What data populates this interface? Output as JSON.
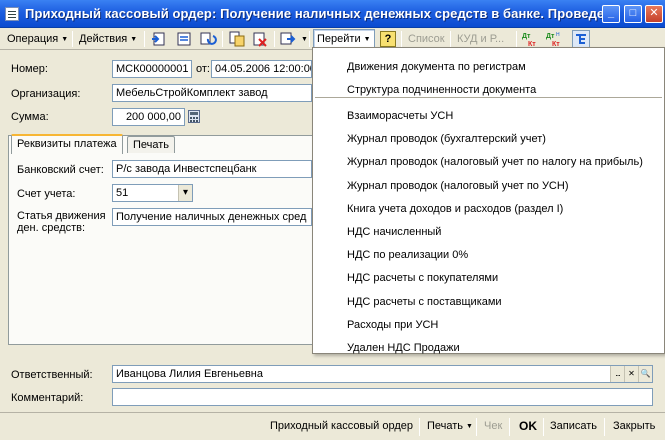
{
  "window": {
    "title": "Приходный кассовый ордер: Получение наличных денежных средств в банке. Проведен",
    "minimize_glyph": "_",
    "maximize_glyph": "□",
    "close_glyph": "✕"
  },
  "toolbar": {
    "operation_label": "Операция",
    "actions_label": "Действия",
    "goto_label": "Перейти",
    "help_glyph": "?",
    "list_label": "Список",
    "kud_label": "КУД и Р...",
    "dt_kt_1": "ДтКт",
    "dt_kt_2": "ДтНКт"
  },
  "form": {
    "number_label": "Номер:",
    "number_value": "МСК00000001",
    "from_label": "от:",
    "date_value": "04.05.2006 12:00:00",
    "org_label": "Организация:",
    "org_value": "МебельСтройКомплект завод",
    "sum_label": "Сумма:",
    "sum_value": "200 000,00",
    "tabs": [
      {
        "label": "Реквизиты платежа",
        "active": true
      },
      {
        "label": "Печать",
        "active": false
      }
    ],
    "bank_label": "Банковский счет:",
    "bank_value": "Р/с завода Инвестспецбанк",
    "account_label": "Счет учета:",
    "account_value": "51",
    "cashflow_label_1": "Статья движения",
    "cashflow_label_2": "ден. средств:",
    "cashflow_value": "Получение наличных денежных сред",
    "responsible_label": "Ответственный:",
    "responsible_value": "Иванцова Лилия Евгеньевна",
    "comment_label": "Комментарий:",
    "comment_value": ""
  },
  "menu": {
    "top_items": [
      "Движения документа по регистрам",
      "Структура подчиненности документа"
    ],
    "items": [
      "Взаиморасчеты УСН",
      "Журнал проводок (бухгалтерский учет)",
      "Журнал проводок (налоговый учет по налогу на прибыль)",
      "Журнал проводок (налоговый учет по УСН)",
      "Книга учета доходов и расходов (раздел I)",
      "НДС начисленный",
      "НДС по реализации 0%",
      "НДС расчеты с покупателями",
      "НДС расчеты с поставщиками",
      "Расходы при УСН",
      "Удален НДС Продажи"
    ]
  },
  "statusbar": {
    "doc_label": "Приходный кассовый ордер",
    "print_label": "Печать",
    "check_label": "Чек",
    "ok_label": "OK",
    "save_label": "Записать",
    "close_label": "Закрыть"
  },
  "colors": {
    "title_blue": "#0a4bd0",
    "window_bg": "#ece9d8",
    "field_border": "#7f9db9"
  }
}
